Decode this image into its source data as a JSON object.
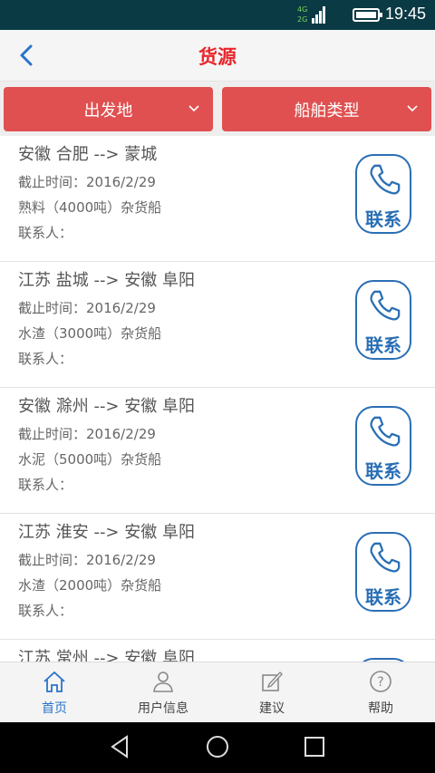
{
  "status_bar": {
    "network_top": "4G",
    "network_bottom": "2G",
    "time": "19:45"
  },
  "header": {
    "title": "货源",
    "back_icon": "chevron-left-icon"
  },
  "filters": {
    "origin_label": "出发地",
    "ship_type_label": "船舶类型"
  },
  "listings": [
    {
      "route": "安徽 合肥 --> 蒙城",
      "deadline": "截止时间：2016/2/29",
      "cargo": "熟料（4000吨）杂货船",
      "contact": "联系人：",
      "contact_button": "联系"
    },
    {
      "route": "江苏 盐城 --> 安徽 阜阳",
      "deadline": "截止时间：2016/2/29",
      "cargo": "水渣（3000吨）杂货船",
      "contact": "联系人：",
      "contact_button": "联系"
    },
    {
      "route": "安徽 滁州 --> 安徽 阜阳",
      "deadline": "截止时间：2016/2/29",
      "cargo": "水泥（5000吨）杂货船",
      "contact": "联系人：",
      "contact_button": "联系"
    },
    {
      "route": "江苏 淮安 --> 安徽 阜阳",
      "deadline": "截止时间：2016/2/29",
      "cargo": "水渣（2000吨）杂货船",
      "contact": "联系人：",
      "contact_button": "联系"
    },
    {
      "route": "江苏 常州 --> 安徽 阜阳",
      "deadline": "",
      "cargo": "",
      "contact": "",
      "contact_button": ""
    }
  ],
  "tabs": [
    {
      "label": "首页",
      "icon": "home-icon",
      "active": true
    },
    {
      "label": "用户信息",
      "icon": "user-icon",
      "active": false
    },
    {
      "label": "建议",
      "icon": "edit-icon",
      "active": false
    },
    {
      "label": "帮助",
      "icon": "help-icon",
      "active": false
    }
  ],
  "colors": {
    "accent_red": "#e05050",
    "title_red": "#e8262c",
    "accent_blue": "#2a6fb5",
    "status_bar": "#0a3a44"
  }
}
